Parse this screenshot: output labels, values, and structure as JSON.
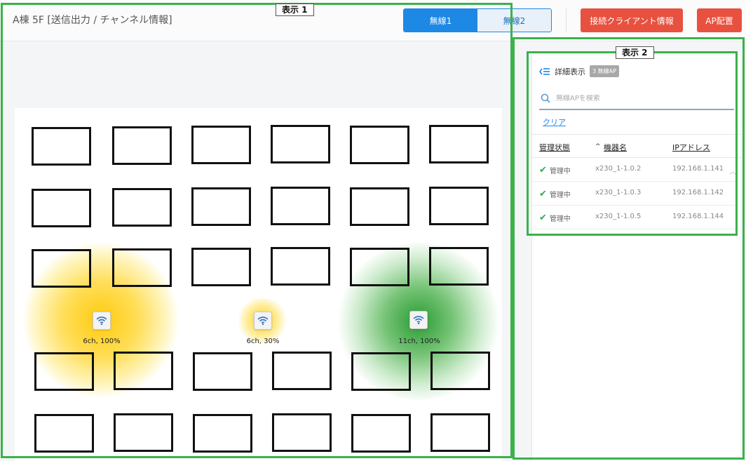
{
  "header": {
    "title": "A棟 5F [送信出力 / チャンネル情報]",
    "tabs": [
      {
        "label": "無線1",
        "active": true
      },
      {
        "label": "無線2",
        "active": false
      }
    ],
    "client_info_button": "接続クライアント情報",
    "ap_placement_button": "AP配置"
  },
  "map": {
    "access_points": [
      {
        "label": "6ch, 100%",
        "heat_color": "#ffc800",
        "icon": "wifi-icon"
      },
      {
        "label": "6ch, 30%",
        "heat_color": "#ffc800",
        "icon": "wifi-icon"
      },
      {
        "label": "11ch, 100%",
        "heat_color": "#1e9e2a",
        "icon": "wifi-icon"
      }
    ]
  },
  "panel": {
    "detail_label": "詳細表示",
    "badge": "3 無線AP",
    "search_placeholder": "無線APを検索",
    "clear_label": "クリア",
    "columns": {
      "status": "管理状態",
      "name": "機器名",
      "ip": "IPアドレス"
    },
    "sort_indicator": "^",
    "rows": [
      {
        "status": "管理中",
        "name": "x230_1-1.0.2",
        "ip": "192.168.1.141"
      },
      {
        "status": "管理中",
        "name": "x230_1-1.0.3",
        "ip": "192.168.1.142"
      },
      {
        "status": "管理中",
        "name": "x230_1-1.0.5",
        "ip": "192.168.1.144"
      }
    ]
  },
  "annotations": {
    "display1": "表示 1",
    "display2": "表示 2"
  },
  "colors": {
    "accent": "#1e88e5",
    "danger": "#e8513f",
    "status_ok": "#35a84a",
    "annotation": "#3bb24a"
  }
}
